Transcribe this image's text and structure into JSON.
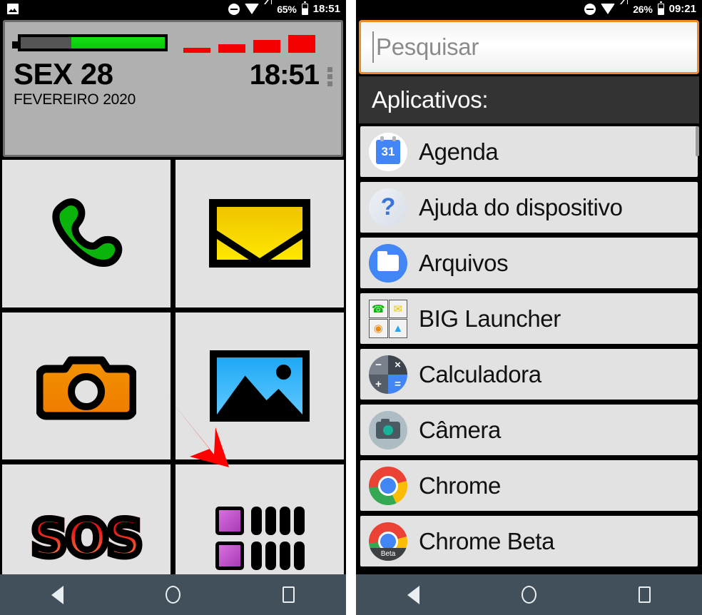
{
  "left_phone": {
    "status_bar": {
      "notification_icon": "screenshot-icon",
      "dnd_icon": "do-not-disturb-icon",
      "wifi_icon": "wifi-icon",
      "signal_icon": "cell-signal-icon",
      "battery_percent": "65%",
      "battery_icon": "battery-icon",
      "clock": "18:51"
    },
    "widget": {
      "battery_bar_icon": "battery-level-bar",
      "battery_fill_percent": 65,
      "signal_bars_icon": "signal-strength-bars",
      "signal_bars_count": 4,
      "day_line": "SEX 28",
      "time": "18:51",
      "month_year": "FEVEREIRO 2020",
      "overflow_icon": "more-options-icon"
    },
    "tiles": [
      {
        "name": "phone",
        "icon": "phone-handset-icon",
        "color": "#0ab40a"
      },
      {
        "name": "messages",
        "icon": "envelope-icon",
        "color": "#ffe800"
      },
      {
        "name": "camera",
        "icon": "camera-icon",
        "color": "#ef8c10"
      },
      {
        "name": "gallery",
        "icon": "picture-icon",
        "color": "#1ea8f5"
      },
      {
        "name": "sos",
        "icon": "sos-text-icon",
        "label": "SOS",
        "color": "#e51616"
      },
      {
        "name": "all-apps",
        "icon": "apps-grid-icon",
        "color": "#a83bb5"
      }
    ],
    "annotation": {
      "icon": "red-arrow-annotation",
      "color": "#ff0000",
      "points_to": "all-apps"
    },
    "nav_bar": {
      "back": "back-icon",
      "home": "home-icon",
      "recents": "recents-icon"
    }
  },
  "right_phone": {
    "status_bar": {
      "dnd_icon": "do-not-disturb-icon",
      "wifi_icon": "wifi-icon",
      "signal_icon": "cell-signal-icon",
      "battery_percent": "26%",
      "battery_icon": "battery-icon",
      "clock": "09:21"
    },
    "search": {
      "placeholder": "Pesquisar",
      "value": "",
      "border_color": "#f08a24"
    },
    "section_header": "Aplicativos:",
    "apps": [
      {
        "label": "Agenda",
        "icon": "calendar-icon",
        "badge": "31"
      },
      {
        "label": "Ajuda do dispositivo",
        "icon": "question-mark-icon",
        "badge": "?"
      },
      {
        "label": "Arquivos",
        "icon": "folder-icon",
        "badge": ""
      },
      {
        "label": "BIG Launcher",
        "icon": "big-launcher-icon",
        "badge": ""
      },
      {
        "label": "Calculadora",
        "icon": "calculator-icon",
        "badge": ""
      },
      {
        "label": "Câmera",
        "icon": "camera-icon",
        "badge": ""
      },
      {
        "label": "Chrome",
        "icon": "chrome-icon",
        "badge": ""
      },
      {
        "label": "Chrome Beta",
        "icon": "chrome-beta-icon",
        "badge": "Beta"
      }
    ],
    "scrollbar": "vertical-scrollbar",
    "nav_bar": {
      "back": "back-icon",
      "home": "home-icon",
      "recents": "recents-icon"
    }
  }
}
